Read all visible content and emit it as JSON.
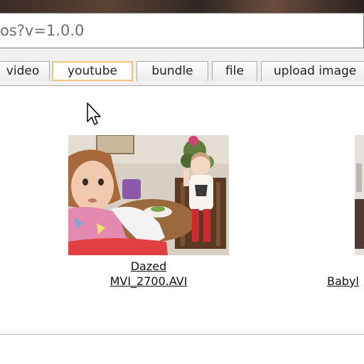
{
  "url_bar": {
    "text": "os?v=1.0.0"
  },
  "tabs": [
    {
      "label": "video",
      "selected": false
    },
    {
      "label": "youtube",
      "selected": true
    },
    {
      "label": "bundle",
      "selected": false
    },
    {
      "label": "file",
      "selected": false
    },
    {
      "label": "upload image",
      "selected": false
    }
  ],
  "videos": [
    {
      "title": "Dazed",
      "filename": "MVI_2700.AVI"
    },
    {
      "title": "Babyl"
    }
  ],
  "colors": {
    "selected_tab_border": "#f0c67a",
    "tab_border": "#a9a9a9",
    "chrome_background": "#f0f0f0"
  }
}
